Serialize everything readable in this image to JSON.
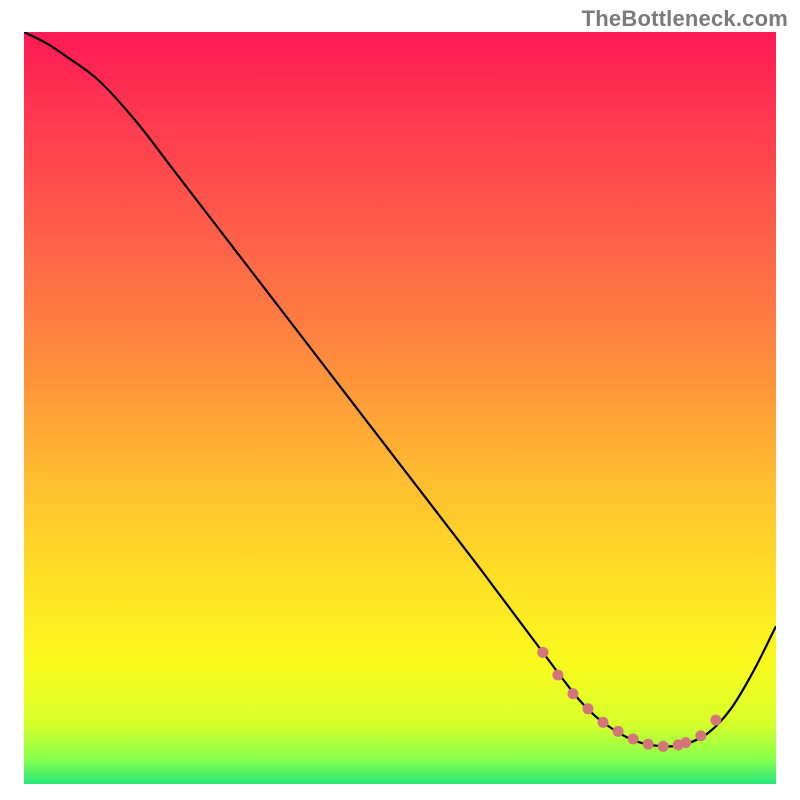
{
  "watermark": "TheBottleneck.com",
  "chart_data": {
    "type": "line",
    "title": "",
    "xlabel": "",
    "ylabel": "",
    "xlim": [
      0,
      100
    ],
    "ylim": [
      0,
      100
    ],
    "grid": false,
    "series": [
      {
        "name": "curve",
        "x": [
          0,
          3,
          6,
          10,
          15,
          20,
          25,
          30,
          35,
          40,
          45,
          50,
          55,
          60,
          63,
          66,
          69,
          72,
          74,
          76,
          78,
          80,
          82,
          84,
          86,
          88,
          91,
          94,
          97,
          100
        ],
        "y": [
          100,
          98.5,
          96.5,
          93.5,
          88,
          81.5,
          75,
          68.5,
          62,
          55.5,
          49,
          42.5,
          36,
          29.5,
          25.5,
          21.5,
          17.5,
          13.5,
          11,
          9,
          7.5,
          6.3,
          5.5,
          5.1,
          5.0,
          5.3,
          6.8,
          10,
          15,
          21
        ]
      }
    ],
    "highlight_points": {
      "name": "optimal-zone-dots",
      "color": "#d4747b",
      "x": [
        69,
        71,
        73,
        75,
        77,
        79,
        81,
        83,
        85,
        87,
        88,
        90,
        92
      ],
      "y": [
        17.5,
        14.5,
        12,
        10,
        8.2,
        7.0,
        6.0,
        5.3,
        5.0,
        5.2,
        5.5,
        6.4,
        8.5
      ]
    },
    "gradient_stops": [
      {
        "offset": 0.0,
        "color": "#ff1a55"
      },
      {
        "offset": 0.12,
        "color": "#ff3a50"
      },
      {
        "offset": 0.25,
        "color": "#ff5a4a"
      },
      {
        "offset": 0.38,
        "color": "#ff7b42"
      },
      {
        "offset": 0.5,
        "color": "#ffa038"
      },
      {
        "offset": 0.62,
        "color": "#ffc42e"
      },
      {
        "offset": 0.74,
        "color": "#ffe324"
      },
      {
        "offset": 0.84,
        "color": "#f9f91e"
      },
      {
        "offset": 0.92,
        "color": "#d7ff2a"
      },
      {
        "offset": 0.965,
        "color": "#8cff4a"
      },
      {
        "offset": 1.0,
        "color": "#28e87a"
      }
    ]
  }
}
